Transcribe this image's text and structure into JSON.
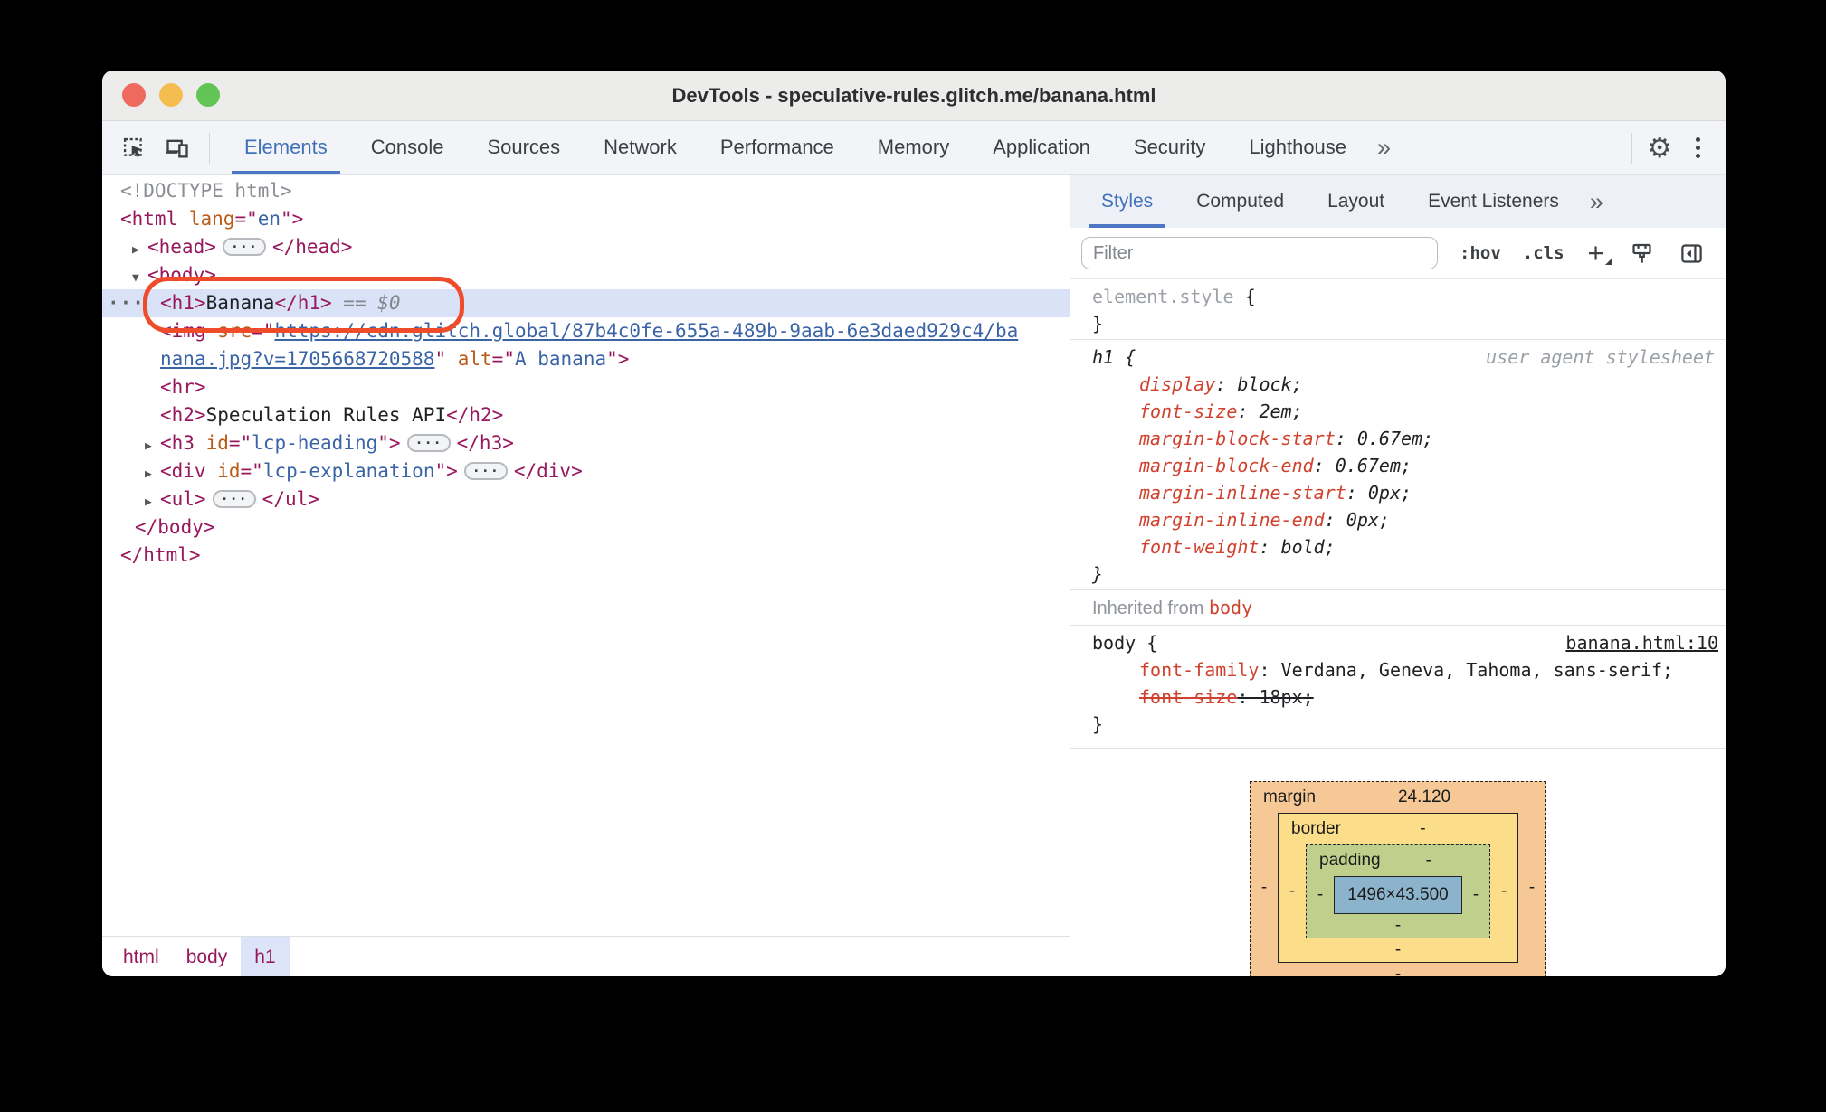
{
  "window": {
    "title": "DevTools - speculative-rules.glitch.me/banana.html"
  },
  "toolbar": {
    "tabs": [
      "Elements",
      "Console",
      "Sources",
      "Network",
      "Performance",
      "Memory",
      "Application",
      "Security",
      "Lighthouse"
    ],
    "more": "»"
  },
  "sidebar": {
    "tabs": [
      "Styles",
      "Computed",
      "Layout",
      "Event Listeners"
    ],
    "more": "»",
    "filter_placeholder": "Filter",
    "hov": ":hov",
    "cls": ".cls",
    "plus": "+"
  },
  "dom": {
    "rows": [
      {
        "cls": "lvl0",
        "segs": [
          {
            "c": "gray",
            "t": "<!DOCTYPE html>"
          }
        ]
      },
      {
        "cls": "lvl0",
        "segs": [
          {
            "c": "tag",
            "t": "<html "
          },
          {
            "c": "attr",
            "t": "lang"
          },
          {
            "c": "tag",
            "t": "=\""
          },
          {
            "c": "val",
            "t": "en"
          },
          {
            "c": "tag",
            "t": "\">"
          }
        ]
      },
      {
        "cls": "lvl1",
        "segs": [
          {
            "c": "arrow",
            "t": "▶",
            "i": true
          },
          {
            "c": "tag",
            "t": "<head>"
          },
          {
            "c": "pill",
            "t": "···",
            "i": true
          },
          {
            "c": "tag",
            "t": "</head>"
          }
        ]
      },
      {
        "cls": "lvl1",
        "segs": [
          {
            "c": "arrow",
            "t": "▼",
            "i": true
          },
          {
            "c": "tag",
            "t": "<body>"
          }
        ]
      },
      {
        "cls": "lvl2 selected",
        "segs": [
          {
            "c": "gutter",
            "t": "···",
            "i": true
          },
          {
            "c": "tag",
            "t": "<h1>"
          },
          {
            "c": "plain",
            "t": "Banana"
          },
          {
            "c": "tag",
            "t": "</h1>"
          },
          {
            "c": "eq",
            "t": " == "
          },
          {
            "c": "dollar",
            "t": "$0"
          }
        ]
      },
      {
        "cls": "lvl2",
        "segs": [
          {
            "c": "tag",
            "t": "<img "
          },
          {
            "c": "attr",
            "t": "src"
          },
          {
            "c": "tag",
            "t": "=\""
          },
          {
            "c": "link",
            "t": "https://cdn.glitch.global/87b4c0fe-655a-489b-9aab-6e3daed929c4/ba",
            "i": true
          }
        ]
      },
      {
        "cls": "lvl2",
        "segs": [
          {
            "c": "link",
            "t": "nana.jpg?v=1705668720588",
            "i": true
          },
          {
            "c": "tag",
            "t": "\" "
          },
          {
            "c": "attr",
            "t": "alt"
          },
          {
            "c": "tag",
            "t": "=\""
          },
          {
            "c": "val",
            "t": "A banana"
          },
          {
            "c": "tag",
            "t": "\">"
          }
        ]
      },
      {
        "cls": "lvl2",
        "segs": [
          {
            "c": "tag",
            "t": "<hr>"
          }
        ]
      },
      {
        "cls": "lvl2",
        "segs": [
          {
            "c": "tag",
            "t": "<h2>"
          },
          {
            "c": "plain",
            "t": "Speculation Rules API"
          },
          {
            "c": "tag",
            "t": "</h2>"
          }
        ]
      },
      {
        "cls": "lvl2",
        "segs": [
          {
            "c": "arrow",
            "t": "▶",
            "i": true
          },
          {
            "c": "tag",
            "t": "<h3 "
          },
          {
            "c": "attr",
            "t": "id"
          },
          {
            "c": "tag",
            "t": "=\""
          },
          {
            "c": "val",
            "t": "lcp-heading"
          },
          {
            "c": "tag",
            "t": "\">"
          },
          {
            "c": "pill",
            "t": "···",
            "i": true
          },
          {
            "c": "tag",
            "t": "</h3>"
          }
        ]
      },
      {
        "cls": "lvl2",
        "segs": [
          {
            "c": "arrow",
            "t": "▶",
            "i": true
          },
          {
            "c": "tag",
            "t": "<div "
          },
          {
            "c": "attr",
            "t": "id"
          },
          {
            "c": "tag",
            "t": "=\""
          },
          {
            "c": "val",
            "t": "lcp-explanation"
          },
          {
            "c": "tag",
            "t": "\">"
          },
          {
            "c": "pill",
            "t": "···",
            "i": true
          },
          {
            "c": "tag",
            "t": "</div>"
          }
        ]
      },
      {
        "cls": "lvl2",
        "segs": [
          {
            "c": "arrow",
            "t": "▶",
            "i": true
          },
          {
            "c": "tag",
            "t": "<ul>"
          },
          {
            "c": "pill",
            "t": "···",
            "i": true
          },
          {
            "c": "tag",
            "t": "</ul>"
          }
        ]
      },
      {
        "cls": "lvl1c",
        "segs": [
          {
            "c": "tag",
            "t": "</body>"
          }
        ]
      },
      {
        "cls": "lvl0",
        "segs": [
          {
            "c": "tag",
            "t": "</html>"
          }
        ]
      }
    ]
  },
  "styles": {
    "element_rows": [
      {
        "segs": [
          {
            "c": "selgray",
            "t": "element.style "
          },
          {
            "c": "brace",
            "t": "{"
          }
        ]
      },
      {
        "segs": [
          {
            "c": "brace",
            "t": "}"
          }
        ]
      }
    ],
    "h1_rows": [
      {
        "cls": "ua flex",
        "segs": [
          {
            "c": "sel",
            "t": "h1 {"
          },
          {
            "c": "origin",
            "t": "user agent stylesheet"
          }
        ]
      },
      {
        "cls": "ua prop",
        "segs": [
          {
            "c": "pname",
            "t": "display"
          },
          {
            "c": "punct",
            "t": ": "
          },
          {
            "c": "pval",
            "t": "block"
          },
          {
            "c": "punct",
            "t": ";"
          }
        ]
      },
      {
        "cls": "ua prop",
        "segs": [
          {
            "c": "pname",
            "t": "font-size"
          },
          {
            "c": "punct",
            "t": ": "
          },
          {
            "c": "pval",
            "t": "2em"
          },
          {
            "c": "punct",
            "t": ";"
          }
        ]
      },
      {
        "cls": "ua prop",
        "segs": [
          {
            "c": "pname",
            "t": "margin-block-start"
          },
          {
            "c": "punct",
            "t": ": "
          },
          {
            "c": "pval",
            "t": "0.67em"
          },
          {
            "c": "punct",
            "t": ";"
          }
        ]
      },
      {
        "cls": "ua prop",
        "segs": [
          {
            "c": "pname",
            "t": "margin-block-end"
          },
          {
            "c": "punct",
            "t": ": "
          },
          {
            "c": "pval",
            "t": "0.67em"
          },
          {
            "c": "punct",
            "t": ";"
          }
        ]
      },
      {
        "cls": "ua prop",
        "segs": [
          {
            "c": "pname",
            "t": "margin-inline-start"
          },
          {
            "c": "punct",
            "t": ": "
          },
          {
            "c": "pval",
            "t": "0px"
          },
          {
            "c": "punct",
            "t": ";"
          }
        ]
      },
      {
        "cls": "ua prop",
        "segs": [
          {
            "c": "pname",
            "t": "margin-inline-end"
          },
          {
            "c": "punct",
            "t": ": "
          },
          {
            "c": "pval",
            "t": "0px"
          },
          {
            "c": "punct",
            "t": ";"
          }
        ]
      },
      {
        "cls": "ua prop",
        "segs": [
          {
            "c": "pname",
            "t": "font-weight"
          },
          {
            "c": "punct",
            "t": ": "
          },
          {
            "c": "pval",
            "t": "bold"
          },
          {
            "c": "punct",
            "t": ";"
          }
        ]
      },
      {
        "cls": "ua",
        "segs": [
          {
            "c": "brace",
            "t": "}"
          }
        ]
      }
    ],
    "inherited": {
      "prefix": "Inherited from ",
      "link": "body"
    },
    "body_rows": [
      {
        "cls": "flex",
        "segs": [
          {
            "c": "sel",
            "t": "body {"
          },
          {
            "c": "srclink",
            "t": "banana.html:10",
            "i": true
          }
        ]
      },
      {
        "cls": "prop",
        "segs": [
          {
            "c": "pname",
            "t": "font-family"
          },
          {
            "c": "punct",
            "t": ": "
          },
          {
            "c": "pval",
            "t": "Verdana, Geneva, Tahoma, sans-serif"
          },
          {
            "c": "punct",
            "t": ";"
          }
        ]
      },
      {
        "cls": "prop struck",
        "segs": [
          {
            "c": "pname",
            "t": "font-size"
          },
          {
            "c": "punct",
            "t": ": "
          },
          {
            "c": "pval",
            "t": "18px"
          },
          {
            "c": "punct",
            "t": ";"
          }
        ]
      },
      {
        "segs": [
          {
            "c": "brace",
            "t": "}"
          }
        ]
      }
    ]
  },
  "box_model": {
    "margin_label": "margin",
    "margin_top": "24.120",
    "border_label": "border",
    "padding_label": "padding",
    "content": "1496×43.500",
    "dash": "-"
  },
  "breadcrumb": [
    "html",
    "body",
    "h1"
  ],
  "colors": {
    "accent": "#4d76c4",
    "selection_bg": "#d9e2f7",
    "annotation": "#ee4c2b",
    "tag": "#97185c",
    "attr_name": "#bb5b17",
    "attr_value": "#3b64a6",
    "prop_red": "#d0422e",
    "bm_margin": "#f6c896",
    "bm_border": "#fbdd8a",
    "bm_padding": "#c0cf8c",
    "bm_content": "#8cb3cc",
    "traffic_red": "#ee6a5f",
    "traffic_yellow": "#f5bd4f",
    "traffic_green": "#61c455"
  }
}
